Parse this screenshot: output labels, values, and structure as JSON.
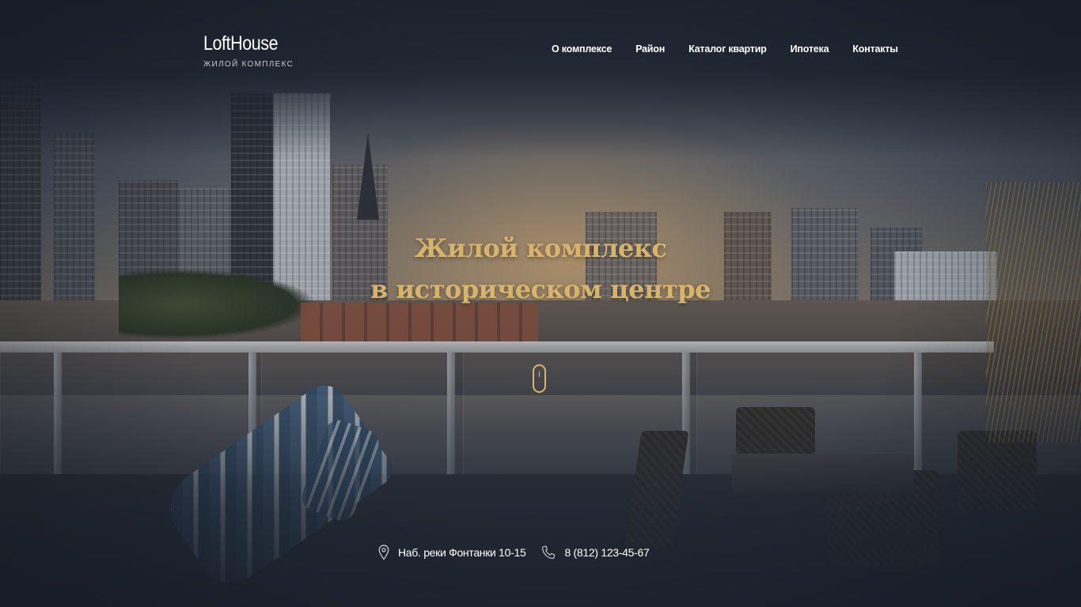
{
  "header": {
    "logo": {
      "name": "LoftHouse",
      "tagline": "жилой комплекс"
    },
    "nav": [
      {
        "label": "О комплексе"
      },
      {
        "label": "Район"
      },
      {
        "label": "Каталог квартир"
      },
      {
        "label": "Ипотека"
      },
      {
        "label": "Контакты"
      }
    ]
  },
  "hero": {
    "title_line1": "Жилой комплекс",
    "title_line2": "в историческом центре",
    "scroll_icon": "mouse-scroll-icon"
  },
  "contacts": {
    "address": "Наб. реки Фонтанки 10-15",
    "address_icon": "location-pin-icon",
    "phone": "8 (812) 123-45-67",
    "phone_icon": "phone-icon"
  },
  "colors": {
    "background": "#1f2733",
    "accent_gold": "#d7b46e",
    "text": "#ffffff"
  }
}
